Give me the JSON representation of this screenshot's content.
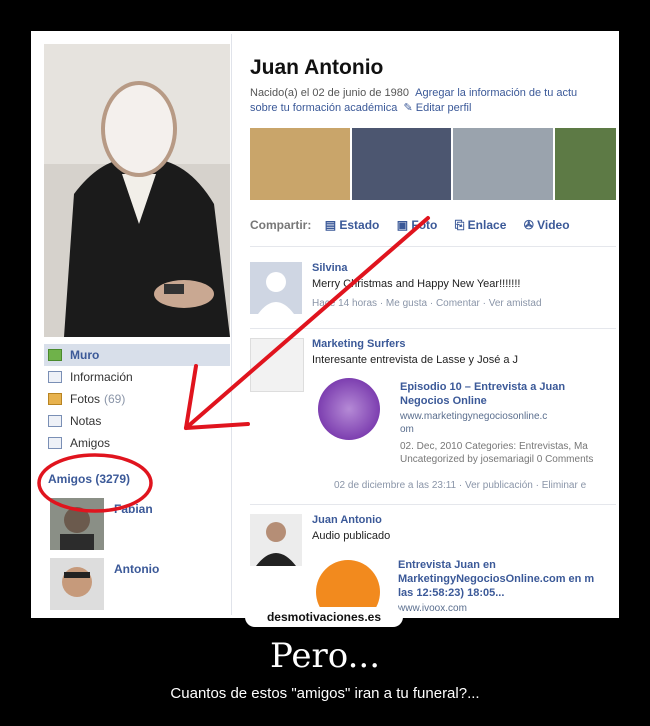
{
  "profile": {
    "name": "Juan Antonio",
    "born": "Nacido(a) el 02 de junio de 1980",
    "add_info": "Agregar la información de tu actu",
    "education": "sobre tu formación académica",
    "edit": "Editar perfil"
  },
  "nav": [
    {
      "label": "Muro",
      "count": ""
    },
    {
      "label": "Información",
      "count": ""
    },
    {
      "label": "Fotos",
      "count": "(69)"
    },
    {
      "label": "Notas",
      "count": ""
    },
    {
      "label": "Amigos",
      "count": ""
    }
  ],
  "friends": {
    "header": "Amigos (3279)",
    "list": [
      "Fabian",
      "Antonio"
    ]
  },
  "share": {
    "label": "Compartir:",
    "options": [
      "Estado",
      "Foto",
      "Enlace",
      "Video"
    ]
  },
  "posts": {
    "p1": {
      "author": "Silvina",
      "text": "Merry Christmas and Happy New Year!!!!!!!",
      "meta": "Hace 14 horas · Me gusta · Comentar · Ver amistad"
    },
    "p2": {
      "author": "Marketing Surfers",
      "text": "Interesante entrevista de Lasse             y José            a J",
      "link_title_1": "Episodio 10 – Entrevista a Juan",
      "link_title_2": "Negocios Online",
      "link_url_1": "www.marketingynegociosonline.c",
      "link_url_2": "om",
      "desc_1": "02. Dec, 2010 Categories: Entrevistas, Ma",
      "desc_2": "Uncategorized by josemariagil 0 Comments",
      "meta": "02 de diciembre a las 23:11 · Ver publicación · Eliminar e"
    },
    "p3": {
      "author": "Juan Antonio",
      "text": "Audio publicado",
      "link_title_1": "Entrevista Juan                    en",
      "link_title_2": "MarketingyNegociosOnline.com en m",
      "link_title_3": "las 12:58:23) 18:05...",
      "link_url": "www.ivoox.com"
    }
  },
  "watermark": "desmotivaciones.es",
  "caption": {
    "title": "Pero...",
    "subtitle": "Cuantos de estos \"amigos\" iran a tu funeral?..."
  },
  "colors": {
    "accent": "#3b5998",
    "annotation": "#e0141e"
  }
}
